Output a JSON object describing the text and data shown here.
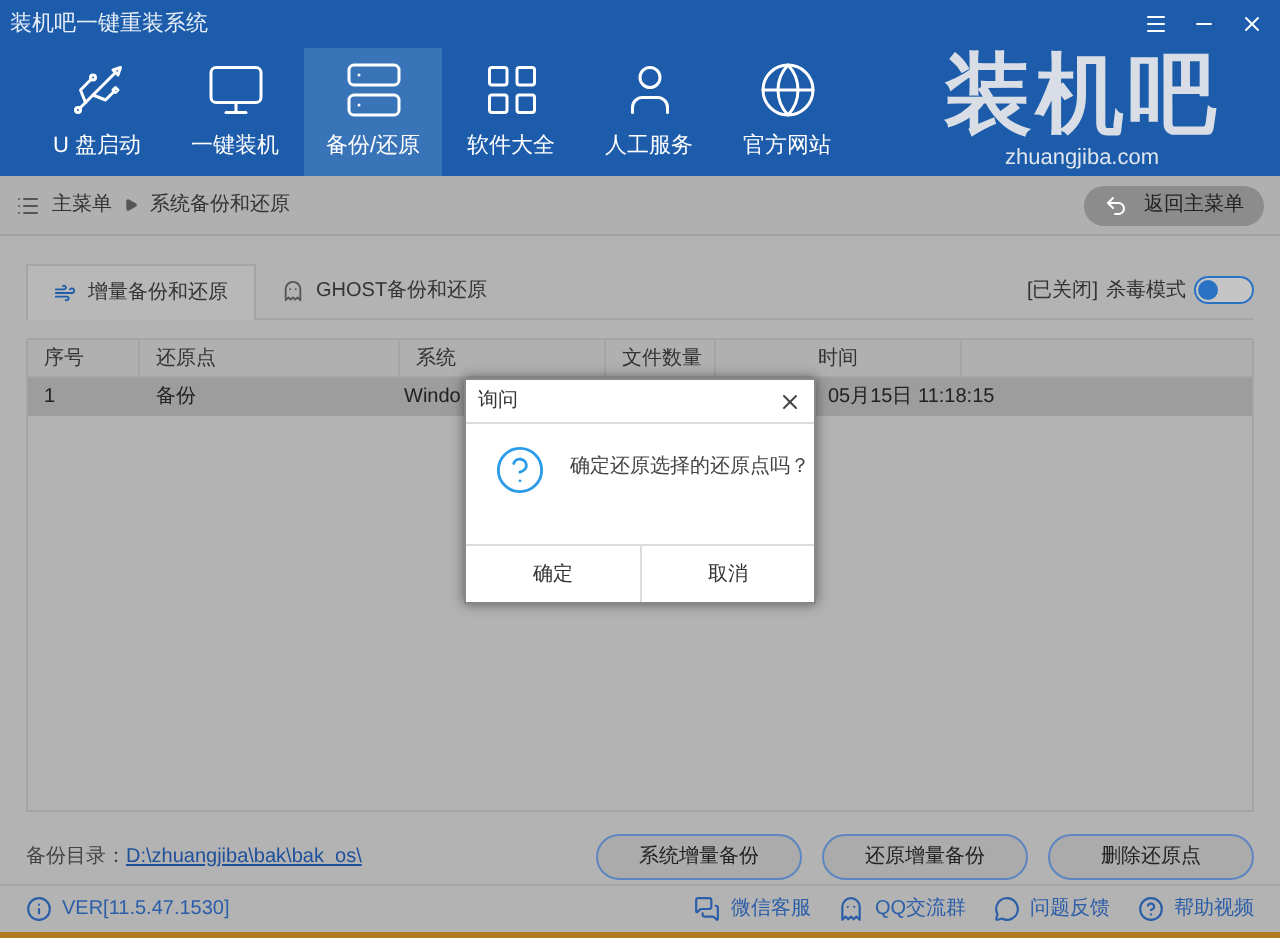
{
  "window": {
    "title": "装机吧一键重装系统"
  },
  "nav": [
    {
      "label": "U 盘启动",
      "selected": false
    },
    {
      "label": "一键装机",
      "selected": false
    },
    {
      "label": "备份/还原",
      "selected": true
    },
    {
      "label": "软件大全",
      "selected": false
    },
    {
      "label": "人工服务",
      "selected": false
    },
    {
      "label": "官方网站",
      "selected": false
    }
  ],
  "logo": {
    "text": "装机吧",
    "url": "zhuangjiba.com"
  },
  "breadcrumb": [
    "主菜单",
    "系统备份和还原"
  ],
  "back_button": "返回主菜单",
  "tabs": [
    {
      "label": "增量备份和还原",
      "selected": true
    },
    {
      "label": "GHOST备份和还原",
      "selected": false
    }
  ],
  "antivirus": {
    "status": "[已关闭]",
    "label": "杀毒模式",
    "on": false
  },
  "table": {
    "columns": [
      "序号",
      "还原点",
      "系统",
      "文件数量",
      "时间"
    ],
    "rows": [
      {
        "cells": [
          "1",
          "备份",
          "Windo",
          "",
          "05月15日 11:18:15"
        ],
        "selected": true
      }
    ]
  },
  "dialog": {
    "title": "询问",
    "message": "确定还原选择的还原点吗？",
    "buttons": [
      "确定",
      "取消"
    ]
  },
  "backup_dir": {
    "label": "备份目录：",
    "path": "D:\\zhuangjiba\\bak\\bak_os\\"
  },
  "action_buttons": [
    "系统增量备份",
    "还原增量备份",
    "删除还原点"
  ],
  "status_bar": {
    "version": "VER[11.5.47.1530]",
    "links": [
      {
        "label": "微信客服"
      },
      {
        "label": "QQ交流群"
      },
      {
        "label": "问题反馈"
      },
      {
        "label": "帮助视频"
      }
    ]
  }
}
